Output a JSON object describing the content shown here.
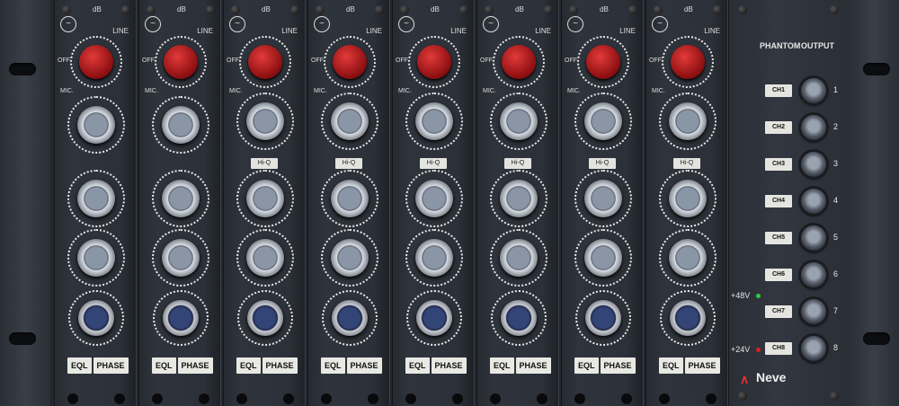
{
  "rack": {
    "brand": "Neve",
    "channel_count": 8,
    "common_labels": {
      "db": "dB",
      "line": "LINE",
      "off": "OFF",
      "mic": "MIC.",
      "hiq": "Hi-Q",
      "eql": "EQL",
      "phase": "PHASE"
    },
    "channels": [
      {
        "id": "1",
        "hiq": false
      },
      {
        "id": "2",
        "hiq": false
      },
      {
        "id": "3",
        "hiq": true
      },
      {
        "id": "4",
        "hiq": true
      },
      {
        "id": "5",
        "hiq": true
      },
      {
        "id": "6",
        "hiq": true
      },
      {
        "id": "7",
        "hiq": true
      },
      {
        "id": "8",
        "hiq": true
      }
    ]
  },
  "master": {
    "phantom_header": "PHANTOM",
    "output_header": "OUTPUT",
    "rows": [
      {
        "ch": "CH1",
        "num": "1"
      },
      {
        "ch": "CH2",
        "num": "2"
      },
      {
        "ch": "CH3",
        "num": "3"
      },
      {
        "ch": "CH4",
        "num": "4"
      },
      {
        "ch": "CH5",
        "num": "5"
      },
      {
        "ch": "CH6",
        "num": "6"
      },
      {
        "ch": "CH7",
        "num": "7"
      },
      {
        "ch": "CH8",
        "num": "8"
      }
    ],
    "v48": "+48V",
    "v24": "+24V",
    "led_48_color": "#2ecc40",
    "led_24_color": "#d62020"
  },
  "colors": {
    "panel": "#2c3038",
    "red_knob": "#c0181c",
    "blue_knob": "#2a3a70",
    "grey_knob": "#8a96a6"
  }
}
